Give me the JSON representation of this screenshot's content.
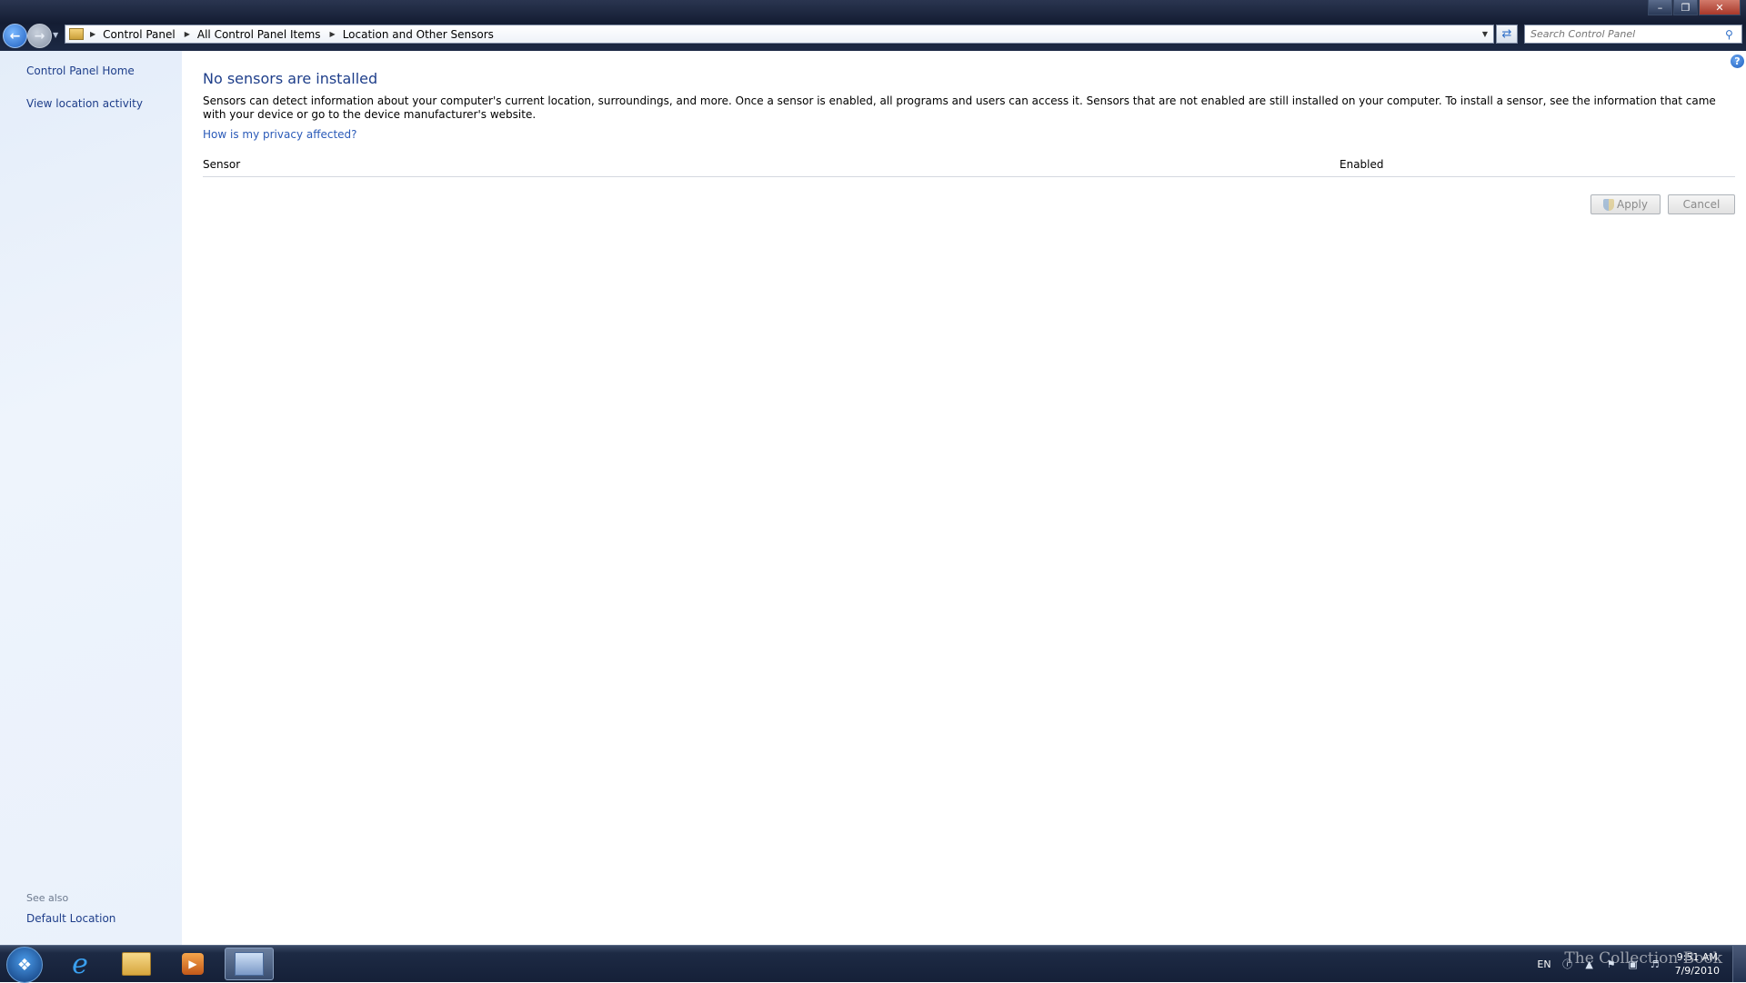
{
  "window": {
    "minimize_icon": "minimize-icon",
    "maximize_icon": "restore-icon",
    "close_icon": "close-icon"
  },
  "address_bar": {
    "breadcrumbs": [
      "Control Panel",
      "All Control Panel Items",
      "Location and Other Sensors"
    ],
    "search_placeholder": "Search Control Panel"
  },
  "sidebar": {
    "links": [
      "Control Panel Home",
      "View location activity"
    ],
    "see_also_label": "See also",
    "see_also_links": [
      "Default Location"
    ]
  },
  "main": {
    "title": "No sensors are installed",
    "description": "Sensors can detect information about your computer's current location, surroundings, and more. Once a sensor is enabled, all programs and users can access it. Sensors that are not enabled are still installed on your computer. To install a sensor, see the information that came with your device or go to the device manufacturer's website.",
    "privacy_link": "How is my privacy affected?",
    "table": {
      "columns": [
        "Sensor",
        "Enabled"
      ]
    },
    "apply_label": "Apply",
    "cancel_label": "Cancel",
    "help_glyph": "?"
  },
  "taskbar": {
    "items": [
      "start-orb",
      "internet-explorer",
      "windows-explorer",
      "media-player",
      "control-panel"
    ],
    "tray": {
      "language": "EN",
      "time": "9:51 AM",
      "date": "7/9/2010"
    },
    "watermark": "The Collection Book"
  },
  "colors": {
    "link": "#1e3e8a",
    "title": "#1e3e8a",
    "sidebar_bg": "#e4edf9"
  }
}
